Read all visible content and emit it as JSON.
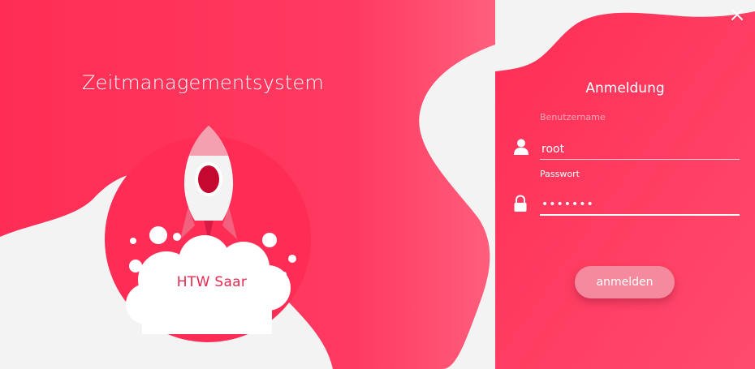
{
  "app": {
    "title": "Zeitmanagementsystem",
    "organization": "HTW Saar"
  },
  "login": {
    "title": "Anmeldung",
    "username_label": "Benutzername",
    "username_value": "root",
    "password_label": "Passwort",
    "password_value": "•••••••",
    "submit_label": "anmelden"
  },
  "icons": {
    "close": "close-icon",
    "user": "user-icon",
    "lock": "lock-icon",
    "rocket": "rocket-icon",
    "cloud": "cloud-icon"
  },
  "colors": {
    "primary": "#ff2d55",
    "primary_light": "#ff5a78",
    "accent_text": "#e8284e",
    "button": "#f58a9e",
    "background": "#f3f3f3"
  }
}
